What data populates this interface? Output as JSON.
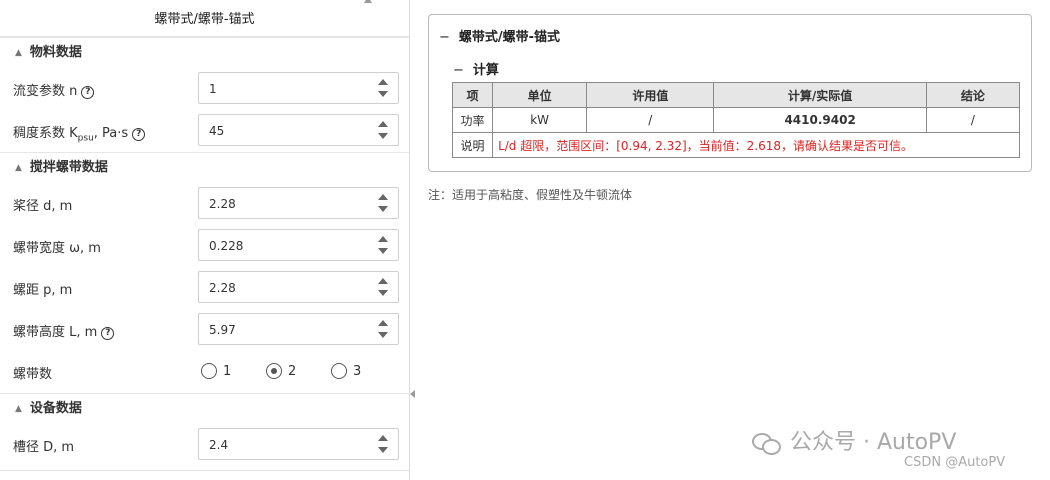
{
  "left": {
    "title": "螺带式/螺带-锚式",
    "material_section": "物料数据",
    "flow_index_label": "流变参数 n",
    "flow_index_value": "1",
    "consistency_label_pre": "稠度系数 K",
    "consistency_label_sub": "psu",
    "consistency_label_post": ", Pa·s",
    "consistency_value": "45",
    "ribbon_section": "搅拌螺带数据",
    "diameter_label": "桨径 d, m",
    "diameter_value": "2.28",
    "width_label": "螺带宽度 ω, m",
    "width_value": "0.228",
    "pitch_label": "螺距 p, m",
    "pitch_value": "2.28",
    "height_label": "螺带高度 L, m",
    "height_value": "5.97",
    "count_label": "螺带数",
    "count_options": [
      "1",
      "2",
      "3"
    ],
    "count_selected": "2",
    "equip_section": "设备数据",
    "tank_label": "槽径 D, m",
    "tank_value": "2.4"
  },
  "right": {
    "card_title": "螺带式/螺带-锚式",
    "sub_title": "计算",
    "headers": [
      "项",
      "单位",
      "许用值",
      "计算/实际值",
      "结论"
    ],
    "row": {
      "item": "功率",
      "unit": "kW",
      "allowed": "/",
      "actual": "4410.9402",
      "conclusion": "/"
    },
    "note_label": "说明",
    "note_text": "L/d 超限，范围区间：[0.94, 2.32]，当前值：2.618，请确认结果是否可信。",
    "footnote": "注：适用于高粘度、假塑性及牛顿流体"
  },
  "watermark": {
    "line1": "公众号 · AutoPV",
    "line2": "CSDN @AutoPV"
  },
  "icons": {
    "collapse": "triangle-up-icon",
    "help": "question-circle-icon",
    "spinner": "spinner-arrows-icon",
    "wechat": "wechat-icon"
  }
}
